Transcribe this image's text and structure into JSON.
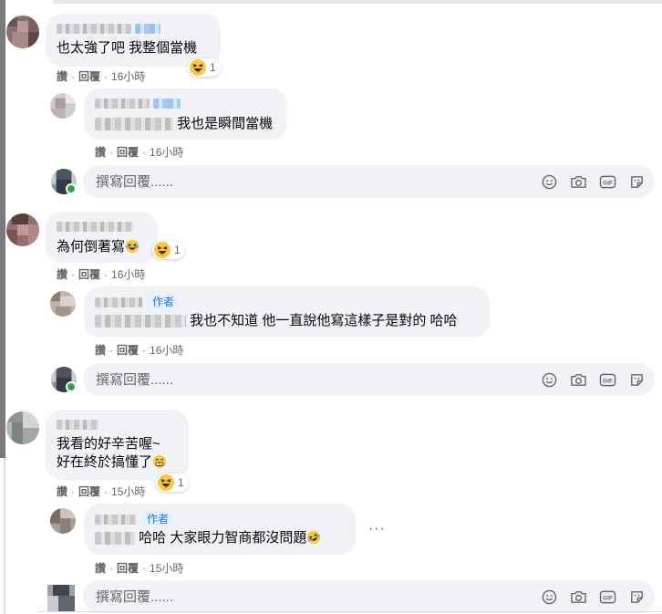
{
  "actions": {
    "like": "讚",
    "reply": "回覆",
    "separator": "·"
  },
  "comments": [
    {
      "text": "也太強了吧 我整個當機",
      "time": "16小時",
      "reaction_count": "1",
      "replies": [
        {
          "text": "我也是瞬間當機",
          "time": "16小時"
        }
      ]
    },
    {
      "text": "為何倒著寫",
      "time": "16小時",
      "reaction_count": "1",
      "replies": [
        {
          "author_badge": "作者",
          "text": "我也不知道 他一直說他寫這樣子是對的 哈哈",
          "time": "16小時"
        }
      ]
    },
    {
      "text_line1": "我看的好辛苦喔~",
      "text_line2": "好在終於搞懂了",
      "time": "15小時",
      "reaction_count": "1",
      "replies": [
        {
          "author_badge": "作者",
          "text": "哈哈 大家眼力智商都沒問題",
          "time": "15小時"
        }
      ]
    }
  ],
  "reply_box": {
    "placeholder": "撰寫回覆......"
  },
  "icons": [
    "haha-reaction-icon",
    "smiley-icon",
    "camera-icon",
    "gif-icon",
    "sticker-icon",
    "more-options-icon"
  ],
  "colors": {
    "bubble": "#f0f2f5",
    "meta_text": "#65676b",
    "author_badge": "#1877f2",
    "online": "#31a24c"
  }
}
